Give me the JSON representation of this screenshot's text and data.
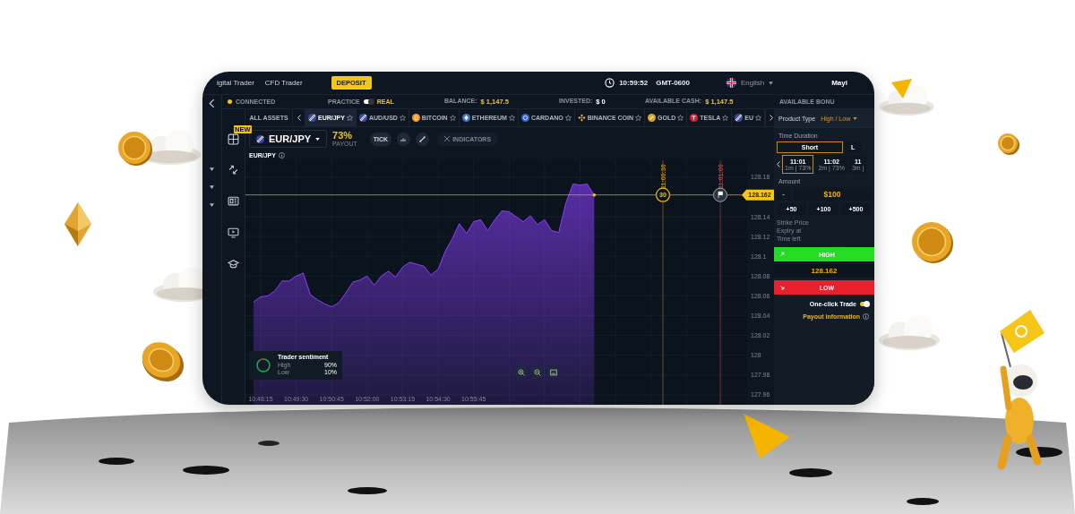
{
  "top_bar": {
    "nav": [
      "igital Trader",
      "CFD Trader"
    ],
    "deposit_button": "DEPOSIT",
    "time": "10:59:52",
    "timezone": "GMT-0600",
    "language": "English",
    "user": "Mayi"
  },
  "status_bar": {
    "connection": "CONNECTED",
    "practice_label": "PRACTICE",
    "real_label": "REAL",
    "real_mode": true,
    "stats": [
      {
        "label": "BALANCE:",
        "value": "$ 1,147.5",
        "highlight": true
      },
      {
        "label": "INVESTED:",
        "value": "$ 0",
        "highlight": false
      },
      {
        "label": "AVAILABLE CASH:",
        "value": "$ 1,147.5",
        "highlight": true
      },
      {
        "label": "AVAILABLE BONU"
      }
    ]
  },
  "side_rail": {
    "new_badge": "NEW"
  },
  "asset_bar": {
    "all_assets": "ALL ASSETS",
    "assets": [
      {
        "name": "EUR/JPY",
        "kind": "pair",
        "selected": true
      },
      {
        "name": "AUD/USD",
        "kind": "pair",
        "selected": false
      },
      {
        "name": "BITCOIN",
        "kind": "orange-coin",
        "selected": false
      },
      {
        "name": "ETHEREUM",
        "kind": "blue-diamond",
        "selected": false
      },
      {
        "name": "CARDANO",
        "kind": "blue-coin",
        "selected": false
      },
      {
        "name": "BINANCE COIN",
        "kind": "yellow-diamond",
        "selected": false
      },
      {
        "name": "GOLD",
        "kind": "gold-coin",
        "selected": false
      },
      {
        "name": "TESLA",
        "kind": "red-logo",
        "selected": false
      },
      {
        "name": "EU",
        "kind": "pair",
        "selected": false
      }
    ]
  },
  "chart_header": {
    "symbol": "EUR/JPY",
    "payout": "73%",
    "payout_label": "PAYOUT",
    "tick_button": "TICK",
    "indicators_button": "INDICATORS"
  },
  "chart": {
    "deadline": {
      "time": "11:00:30",
      "countdown": "30"
    },
    "expiry": {
      "time": "11:01:00"
    },
    "chart_data": {
      "type": "area",
      "grid": true,
      "categories": [
        null,
        "10:48:15",
        null,
        null,
        null,
        null,
        "10:49:30",
        null,
        null,
        null,
        null,
        "10:50:45",
        null,
        null,
        null,
        null,
        "10:52:00",
        null,
        null,
        null,
        null,
        "10:53:15",
        null,
        null,
        null,
        null,
        "10:54:30",
        null,
        null,
        null,
        null,
        "10:55:45",
        null,
        null,
        null,
        null,
        null,
        null,
        null,
        null,
        null,
        null,
        null,
        null,
        null,
        null,
        null,
        null,
        null
      ],
      "series": [
        {
          "name": "EUR/JPY",
          "color": "#8a3ffc",
          "values": [
            128.054,
            128.059,
            128.06,
            128.065,
            128.075,
            128.075,
            128.08,
            128.083,
            128.061,
            128.056,
            128.052,
            128.049,
            128.053,
            128.063,
            128.074,
            128.076,
            128.08,
            128.071,
            128.08,
            128.085,
            128.079,
            128.089,
            128.094,
            128.092,
            128.09,
            128.081,
            128.087,
            128.105,
            128.118,
            128.133,
            128.123,
            128.135,
            128.137,
            128.126,
            128.137,
            128.146,
            128.145,
            128.14,
            128.135,
            128.141,
            128.132,
            128.137,
            128.126,
            128.124,
            128.154,
            128.173,
            128.172,
            128.173,
            128.162
          ]
        }
      ],
      "ylim": [
        127.95,
        128.197
      ],
      "yticks": [
        127.96,
        127.98,
        128,
        128.02,
        128.04,
        128.06,
        128.08,
        128.1,
        128.12,
        128.14,
        128.18
      ],
      "ref_lines": [
        {
          "axis": "y",
          "value": 128.162,
          "label": "128.162"
        }
      ]
    },
    "sentiment": {
      "title": "Trader sentiment",
      "level": 0.9,
      "rows": [
        {
          "label": "High",
          "value": "90%"
        },
        {
          "label": "Low",
          "value": "10%"
        }
      ]
    }
  },
  "trade_panel": {
    "product_type_label": "Product Type",
    "product_type": "High / Low",
    "duration_label": "Time Duration",
    "duration_tabs": [
      {
        "label": "Short",
        "selected": true
      },
      {
        "label": "L",
        "selected": false
      }
    ],
    "times": [
      {
        "time": "11:01",
        "detail": "1m | 73%",
        "selected": true
      },
      {
        "time": "11:02",
        "detail": "2m | 73%",
        "selected": false
      },
      {
        "time": "11",
        "detail": "3m |",
        "selected": false
      }
    ],
    "amount_label": "Amount",
    "minus_button": "-",
    "amount": "$100",
    "increments": [
      "+50",
      "+100",
      "+500"
    ],
    "info": [
      "Strike Price",
      "Expiry at",
      "Time left"
    ],
    "high_button": "HIGH",
    "price": "128.162",
    "low_button": "LOW",
    "one_click_label": "One-click Trade",
    "one_click": true,
    "payout_info": "Payout information"
  }
}
